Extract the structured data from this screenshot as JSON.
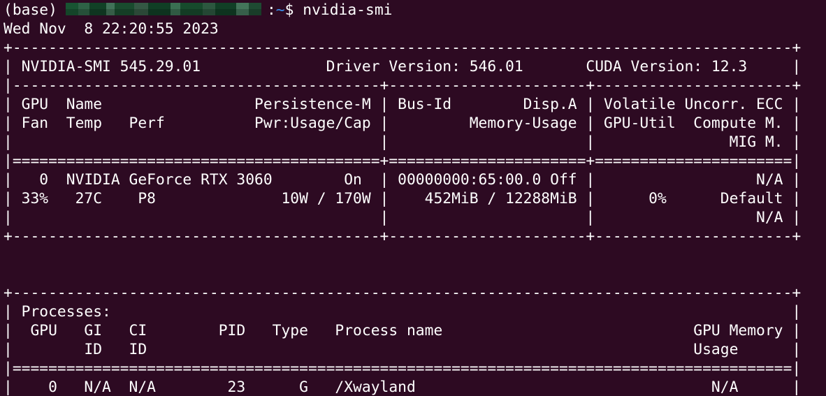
{
  "prompt": {
    "env": "(base)",
    "path": "~",
    "symbol": "$",
    "command": "nvidia-smi"
  },
  "timestamp": "Wed Nov  8 22:20:55 2023",
  "smi_table": [
    "+---------------------------------------------------------------------------------------+",
    "| NVIDIA-SMI 545.29.01              Driver Version: 546.01       CUDA Version: 12.3     |",
    "|-----------------------------------------+----------------------+----------------------+",
    "| GPU  Name                 Persistence-M | Bus-Id        Disp.A | Volatile Uncorr. ECC |",
    "| Fan  Temp   Perf          Pwr:Usage/Cap |         Memory-Usage | GPU-Util  Compute M. |",
    "|                                         |                      |               MIG M. |",
    "|=========================================+======================+======================|",
    "|   0  NVIDIA GeForce RTX 3060        On  | 00000000:65:00.0 Off |                  N/A |",
    "| 33%   27C    P8              10W / 170W |    452MiB / 12288MiB |      0%      Default |",
    "|                                         |                      |                  N/A |",
    "+-----------------------------------------+----------------------+----------------------+",
    "",
    "",
    "+---------------------------------------------------------------------------------------+",
    "| Processes:                                                                            |",
    "|  GPU   GI   CI        PID   Type   Process name                            GPU Memory |",
    "|        ID   ID                                                             Usage      |",
    "|=======================================================================================|",
    "|    0   N/A  N/A        23      G   /Xwayland                                 N/A      |",
    "+---------------------------------------------------------------------------------------+"
  ],
  "colors": {
    "background": "#2d0a22",
    "text": "#ffffff",
    "path": "#3b8eea"
  }
}
